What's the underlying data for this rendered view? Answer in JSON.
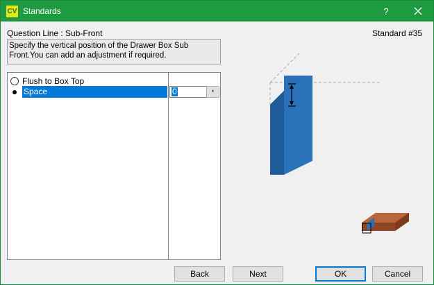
{
  "window": {
    "app_icon_text": "CV",
    "title": "Standards",
    "help_label": "?",
    "accent_color": "#1e9b41"
  },
  "header": {
    "question_line": "Question Line : Sub-Front",
    "standard_number": "Standard #35"
  },
  "description": "Specify the vertical position of the Drawer Box Sub Front.You can add an adjustment if required.",
  "options": [
    {
      "label": "Flush to Box Top",
      "selected": false
    },
    {
      "label": "Space",
      "selected": true
    }
  ],
  "space_value": "0",
  "space_value_button": "*",
  "buttons": {
    "back": "Back",
    "next": "Next",
    "ok": "OK",
    "cancel": "Cancel"
  },
  "colors": {
    "selection": "#0078d7",
    "panel_front": "#2a6fb8",
    "drawer_brown": "#a0542a"
  }
}
